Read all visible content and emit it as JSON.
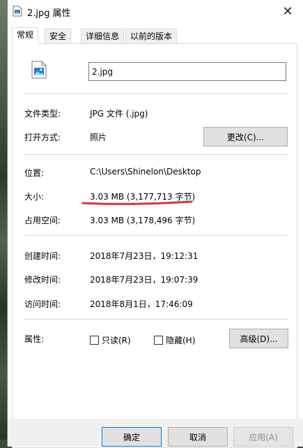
{
  "window": {
    "title": "2.jpg 属性",
    "close_glyph": "✕"
  },
  "tabs": [
    {
      "label": "常规",
      "active": true
    },
    {
      "label": "安全",
      "active": false
    },
    {
      "label": "详细信息",
      "active": false
    },
    {
      "label": "以前的版本",
      "active": false
    }
  ],
  "general": {
    "file_name": "2.jpg",
    "file_type_label": "文件类型:",
    "file_type_value": "JPG 文件 (.jpg)",
    "opens_with_label": "打开方式:",
    "opens_with_value": "照片",
    "change_button": "更改(C)...",
    "location_label": "位置:",
    "location_value": "C:\\Users\\Shinelon\\Desktop",
    "size_label": "大小:",
    "size_value": "3.03 MB (3,177,713 字节)",
    "size_on_disk_label": "占用空间:",
    "size_on_disk_value": "3.03 MB (3,178,496 字节)",
    "created_label": "创建时间:",
    "created_value": "2018年7月23日，19:12:31",
    "modified_label": "修改时间:",
    "modified_value": "2018年7月23日，19:07:39",
    "accessed_label": "访问时间:",
    "accessed_value": "2018年8月1日，17:46:09",
    "attributes_label": "属性:",
    "readonly_label": "只读(R)",
    "hidden_label": "隐藏(H)",
    "advanced_button": "高级(D)..."
  },
  "footer": {
    "ok": "确定",
    "cancel": "取消",
    "apply": "应用(A)"
  },
  "colors": {
    "annotation_underline": "#d8343c",
    "image_icon_blue": "#2f7fd1"
  },
  "icons": [
    "image-file-icon",
    "close-icon",
    "underline-annotation"
  ]
}
